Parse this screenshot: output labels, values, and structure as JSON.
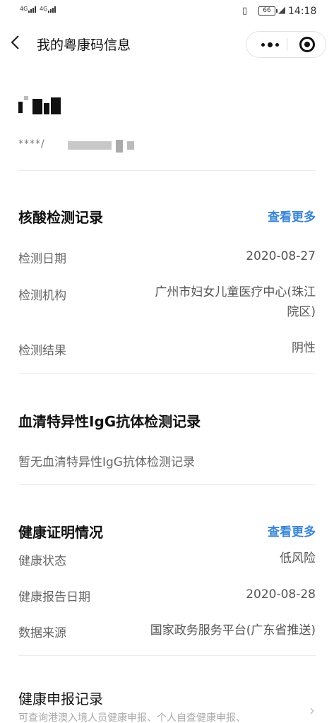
{
  "status_bar": {
    "signal1": "4G",
    "signal2": "4G",
    "battery": "66",
    "time": "14:18"
  },
  "nav": {
    "back_icon": "chevron-left-icon",
    "title": "我的粤康码信息",
    "menu_icon": "more-dots-icon",
    "close_icon": "target-icon"
  },
  "user": {
    "id_masked": "****/"
  },
  "nucleic": {
    "title": "核酸检测记录",
    "more": "查看更多",
    "date_label": "检测日期",
    "date_value": "2020-08-27",
    "org_label": "检测机构",
    "org_value_line1": "广州市妇女儿童医疗中心(珠江",
    "org_value_line2": "院区)",
    "result_label": "检测结果",
    "result_value": "阴性"
  },
  "igg": {
    "title": "血清特异性IgG抗体检测记录",
    "empty": "暂无血清特异性IgG抗体检测记录"
  },
  "health": {
    "title": "健康证明情况",
    "more": "查看更多",
    "status_label": "健康状态",
    "status_value": "低风险",
    "date_label": "健康报告日期",
    "date_value": "2020-08-28",
    "source_label": "数据来源",
    "source_value": "国家政务服务平台(广东省推送)"
  },
  "declare": {
    "title": "健康申报记录",
    "subtitle": "可查询港澳入境人员健康申报、个人自查健康申报、"
  },
  "colors": {
    "link": "#3a86d6",
    "divider": "#ececec"
  }
}
